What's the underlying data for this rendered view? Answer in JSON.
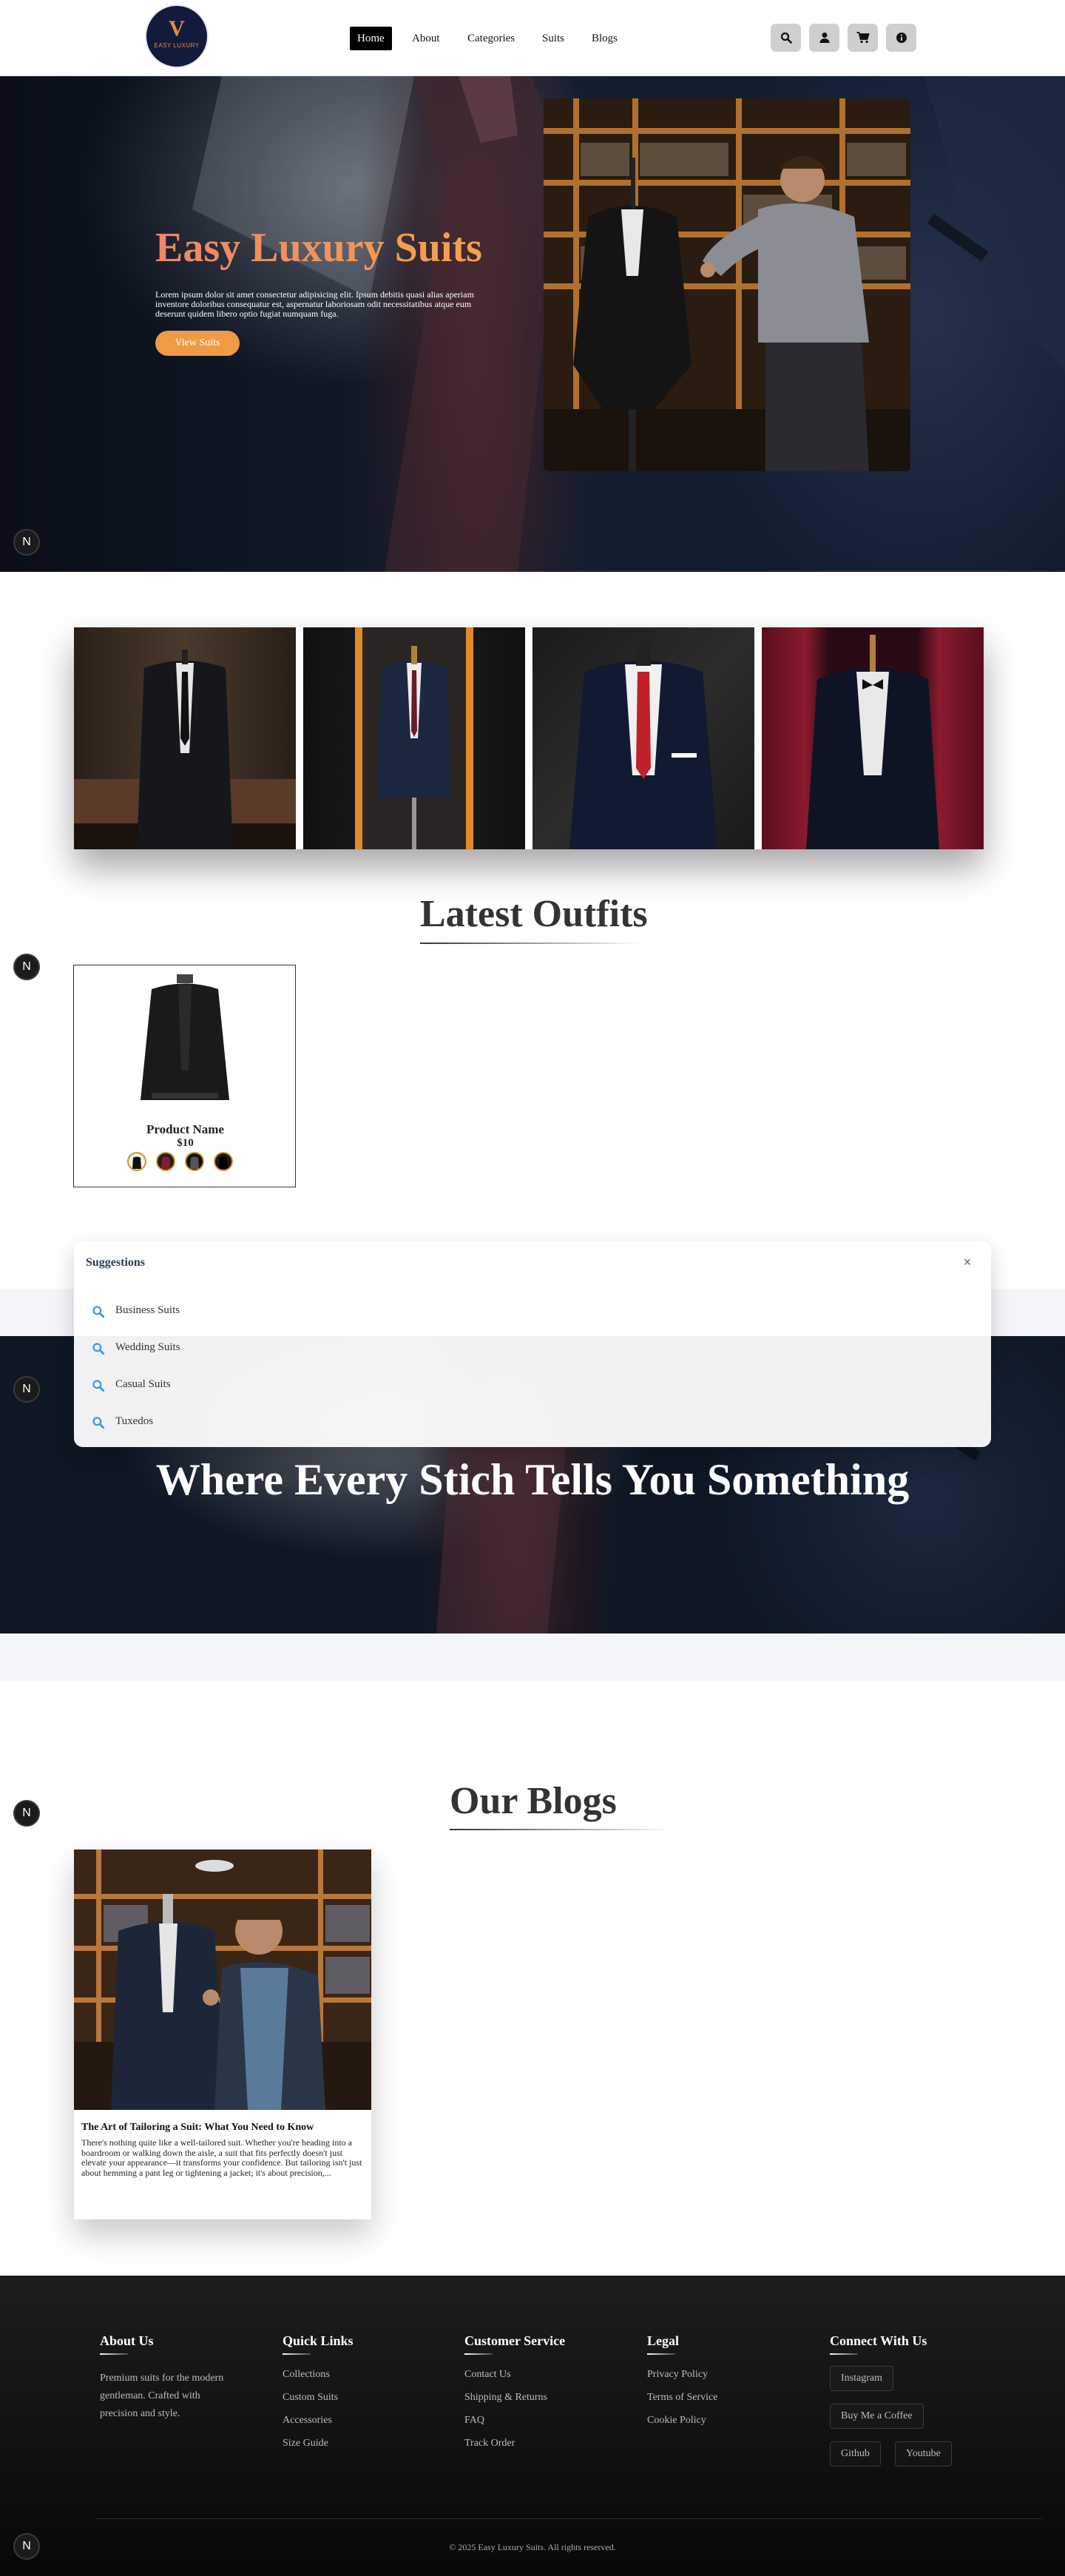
{
  "brand": {
    "logo_text": "EASY LUXURY",
    "logo_mark": "V"
  },
  "nav": {
    "links": [
      {
        "label": "Home",
        "active": true
      },
      {
        "label": "About",
        "active": false
      },
      {
        "label": "Categories",
        "active": false
      },
      {
        "label": "Suits",
        "active": false
      },
      {
        "label": "Blogs",
        "active": false
      }
    ],
    "icons": [
      "search-icon",
      "user-icon",
      "cart-icon",
      "info-icon"
    ]
  },
  "hero": {
    "title": "Easy Luxury Suits",
    "text": "Lorem ipsum dolor sit amet consectetur adipisicing elit. Ipsum debitis quasi alias aperiam inventore doloribus consequatur est, aspernatur laboriosam odit necessitatibus atque eum deserunt quidem libero optio fugiat numquam fuga.",
    "button": "View Suits"
  },
  "badge": "N",
  "latest": {
    "heading": "Latest Outfits",
    "product": {
      "name": "Product Name",
      "price": "$10"
    }
  },
  "suggestions": {
    "title": "Suggestions",
    "close": "×",
    "items": [
      "Business Suits",
      "Wedding Suits",
      "Casual Suits",
      "Tuxedos"
    ]
  },
  "banner": {
    "title": "Where Every Stich Tells You Something"
  },
  "blogs": {
    "heading": "Our Blogs",
    "post": {
      "title": "The Art of Tailoring a Suit: What You Need to Know",
      "excerpt": "There's nothing quite like a well-tailored suit. Whether you're heading into a boardroom or walking down the aisle, a suit that fits perfectly doesn't just elevate your appearance—it transforms your confidence. But tailoring isn't just about hemming a pant leg or tightening a jacket; it's about precision,..."
    }
  },
  "footer": {
    "about": {
      "heading": "About Us",
      "text": "Premium suits for the modern gentleman. Crafted with precision and style."
    },
    "quick": {
      "heading": "Quick Links",
      "links": [
        "Collections",
        "Custom Suits",
        "Accessories",
        "Size Guide"
      ]
    },
    "service": {
      "heading": "Customer Service",
      "links": [
        "Contact Us",
        "Shipping & Returns",
        "FAQ",
        "Track Order"
      ]
    },
    "legal": {
      "heading": "Legal",
      "links": [
        "Privacy Policy",
        "Terms of Service",
        "Cookie Policy"
      ]
    },
    "connect": {
      "heading": "Connect With Us",
      "buttons": [
        "Instagram",
        "Buy Me a Coffee",
        "Github",
        "Youtube"
      ]
    },
    "copyright": "© 2025 Easy Luxury Suits. All rights reserved."
  },
  "colors": {
    "accent": "#ef9a45",
    "hero_gradient_start": "#f0856a",
    "nav_active": "#000000",
    "footer_bg": "#141414"
  }
}
